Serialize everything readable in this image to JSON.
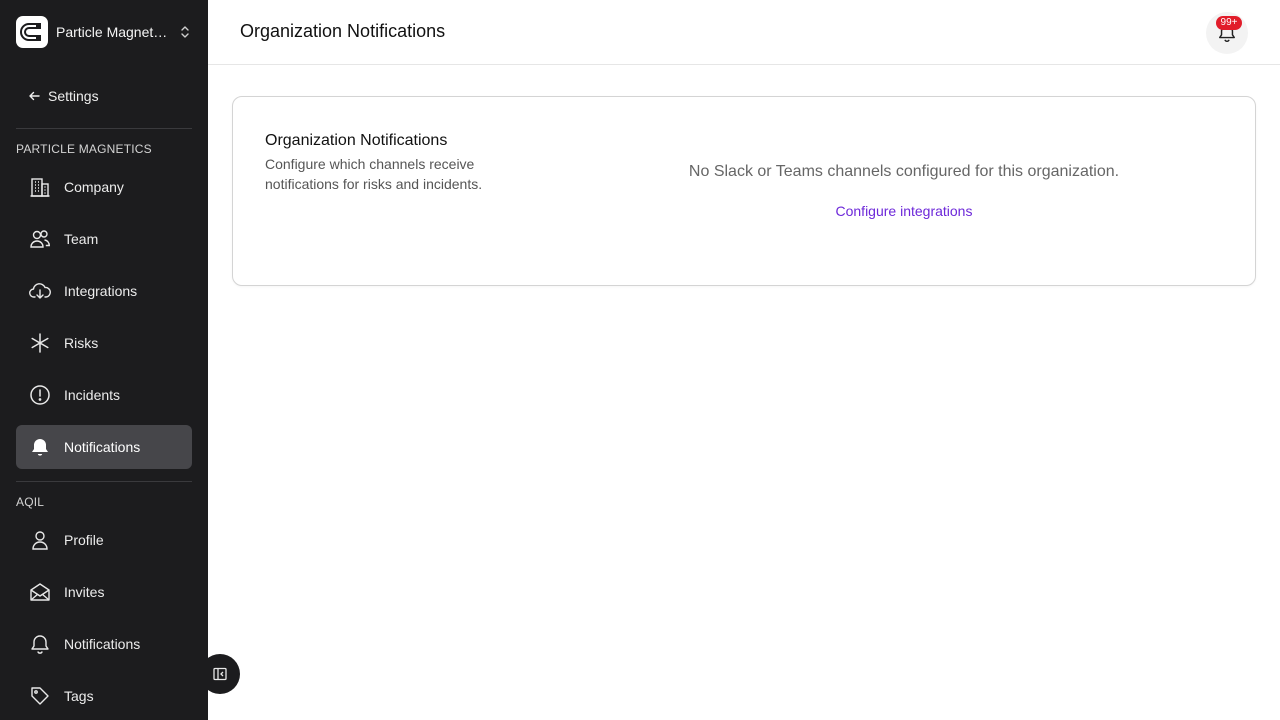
{
  "org": {
    "name": "Particle Magnetics"
  },
  "sidebar": {
    "back_label": "Settings",
    "org_section_label": "PARTICLE MAGNETICS",
    "org_items": [
      {
        "label": "Company",
        "icon": "building-icon"
      },
      {
        "label": "Team",
        "icon": "users-icon"
      },
      {
        "label": "Integrations",
        "icon": "cloud-download-icon"
      },
      {
        "label": "Risks",
        "icon": "asterisk-icon"
      },
      {
        "label": "Incidents",
        "icon": "alert-circle-icon"
      },
      {
        "label": "Notifications",
        "icon": "bell-icon",
        "active": true
      }
    ],
    "user_section_label": "AQIL",
    "user_items": [
      {
        "label": "Profile",
        "icon": "user-icon"
      },
      {
        "label": "Invites",
        "icon": "mail-open-icon"
      },
      {
        "label": "Notifications",
        "icon": "bell-outline-icon"
      },
      {
        "label": "Tags",
        "icon": "tag-icon"
      }
    ]
  },
  "header": {
    "title": "Organization Notifications",
    "notification_badge": "99+"
  },
  "card": {
    "title": "Organization Notifications",
    "description": "Configure which channels receive notifications for risks and incidents.",
    "empty_message": "No Slack or Teams channels configured for this organization.",
    "action_label": "Configure integrations"
  },
  "colors": {
    "sidebar_bg": "#1c1c1e",
    "active_item_bg": "#46464a",
    "link": "#6d28d9",
    "badge": "#e11d2a"
  }
}
